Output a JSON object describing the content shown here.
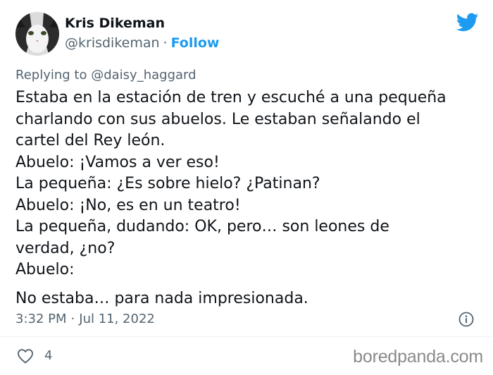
{
  "author": {
    "name": "Kris Dikeman",
    "handle": "@krisdikeman",
    "separator": "·",
    "follow_label": "Follow"
  },
  "reply": {
    "prefix": "Replying to",
    "handle": "@daisy_haggard"
  },
  "body": {
    "lines": [
      "Estaba en la estación de tren y escuché a una pequeña",
      "charlando con sus abuelos. Le estaban señalando el",
      "cartel del Rey león.",
      "Abuelo: ¡Vamos a ver eso!",
      "La pequeña: ¿Es sobre hielo? ¿Patinan?",
      "Abuelo: ¡No, es en un teatro!",
      "La pequeña, dudando: OK, pero… son leones de",
      "verdad, ¿no?",
      "Abuelo:"
    ],
    "final_line": "No estaba… para nada impresionada."
  },
  "meta": {
    "time": "3:32 PM",
    "separator": "·",
    "date": "Jul 11, 2022"
  },
  "actions": {
    "like_count": "4"
  },
  "watermark": "boredpanda.com",
  "icons": {
    "brand": "twitter-bird-icon",
    "info": "info-icon",
    "like": "heart-icon"
  },
  "colors": {
    "accent": "#1d9bf0",
    "text": "#0f1419",
    "secondary": "#536471",
    "watermark": "#8a8a8a"
  }
}
